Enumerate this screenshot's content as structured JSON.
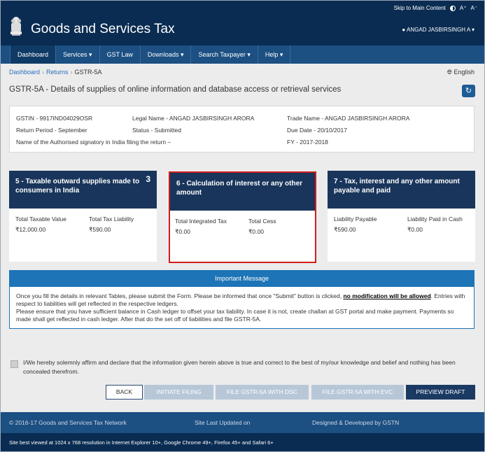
{
  "header": {
    "skip_link": "Skip to Main Content",
    "font_increase": "A⁺",
    "font_decrease": "A⁻",
    "site_title": "Goods and Services Tax",
    "user_name": "ANGAD JASBIRSINGH A"
  },
  "nav": [
    {
      "label": "Dashboard"
    },
    {
      "label": "Services ▾"
    },
    {
      "label": "GST Law"
    },
    {
      "label": "Downloads ▾"
    },
    {
      "label": "Search Taxpayer ▾"
    },
    {
      "label": "Help ▾"
    }
  ],
  "breadcrumb": {
    "items": [
      "Dashboard",
      "Returns",
      "GSTR-5A"
    ]
  },
  "language": "English",
  "page_title": "GSTR-5A - Details of supplies of online information and database access or retrieval services",
  "info": {
    "gstin": "GSTIN - 9917IND04029OSR",
    "legal_name": "Legal Name - ANGAD JASBIRSINGH ARORA",
    "trade_name": "Trade Name - ANGAD JASBIRSINGH ARORA",
    "return_period": "Return Period - September",
    "status": "Status - Submitted",
    "due_date": "Due Date - 20/10/2017",
    "signatory": "Name of the Authorised signatory in India filing the return –",
    "fy": "FY - 2017-2018"
  },
  "tiles": [
    {
      "title": "5 - Taxable outward supplies made to consumers in India",
      "badge": "3",
      "label1": "Total Taxable Value",
      "label2": "Total Tax Liability",
      "value1": "₹12,000.00",
      "value2": "₹590.00"
    },
    {
      "title": "6 - Calculation of interest or any other amount",
      "label1": "Total Integrated Tax",
      "label2": "Total Cess",
      "value1": "₹0.00",
      "value2": "₹0.00"
    },
    {
      "title": "7 - Tax, interest and any other amount payable and paid",
      "label1": "Liability Payable",
      "label2": "Liability Paid in Cash",
      "value1": "₹590.00",
      "value2": "₹0.00"
    }
  ],
  "message": {
    "title": "Important Message",
    "line1_pre": "Once you fill the details in relevant Tables, please submit the Form. Please be informed that once \"Submit\" button is clicked, ",
    "line1_bold": "no modification will be allowed",
    "line1_post": ". Entries with respect to liabilities will get reflected in the respective ledgers.",
    "line2": "Please ensure that you have sufficient balance in Cash ledger to offset your tax liability. In case it is not, create challan at GST portal and make payment. Payments so made shall get reflected in cash ledger. After that do the set off of liabilities and file GSTR-5A."
  },
  "affirmation": "I/We hereby solemnly affirm and declare that the information given herein above is true and correct to the best of my/our knowledge and belief and nothing has been concealed therefrom.",
  "buttons": {
    "back": "BACK",
    "initiate": "INITIATE FILING",
    "dsc": "FILE GSTR-5A WITH DSC",
    "evc": "FILE GSTR-5A WITH EVC",
    "preview": "PREVIEW DRAFT"
  },
  "footer": {
    "copyright": "© 2016-17 Goods and Services Tax Network",
    "updated": "Site Last Updated on",
    "developed": "Designed & Developed by GSTN",
    "browser_note": "Site best viewed at 1024 x 768 resolution in Internet Explorer 10+, Google Chrome 49+, Firefox 45+ and Safari 6+"
  }
}
